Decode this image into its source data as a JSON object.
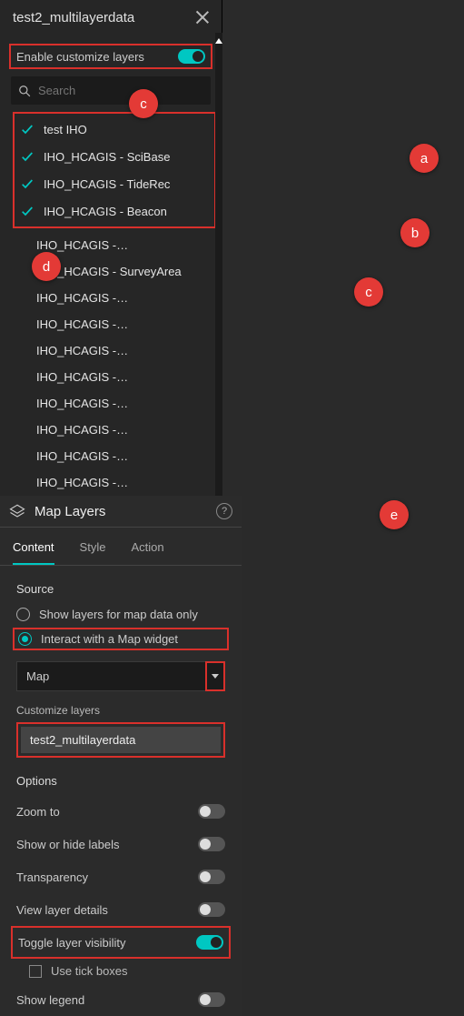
{
  "left": {
    "title": "test2_multilayerdata",
    "enable_label": "Enable customize layers",
    "search_placeholder": "Search",
    "layers_checked": [
      "test IHO",
      "IHO_HCAGIS - SciBase",
      "IHO_HCAGIS - TideRec",
      "IHO_HCAGIS - Beacon"
    ],
    "layers_rest": [
      "IHO_HCAGIS -…",
      "IHO_HCAGIS - SurveyArea",
      "IHO_HCAGIS -…",
      "IHO_HCAGIS -…",
      "IHO_HCAGIS -…",
      "IHO_HCAGIS -…",
      "IHO_HCAGIS -…",
      "IHO_HCAGIS -…",
      "IHO_HCAGIS -…",
      "IHO_HCAGIS -…"
    ]
  },
  "right": {
    "title": "Map Layers",
    "tabs": {
      "content": "Content",
      "style": "Style",
      "action": "Action"
    },
    "source_label": "Source",
    "radio1": "Show layers for map data only",
    "radio2": "Interact with a Map widget",
    "map_select": "Map",
    "customize_label": "Customize layers",
    "selected_layer": "test2_multilayerdata",
    "options_label": "Options",
    "opts": {
      "zoom": "Zoom to",
      "labels": "Show or hide labels",
      "transparency": "Transparency",
      "details": "View layer details",
      "toggle": "Toggle layer visibility",
      "tick": "Use tick boxes",
      "legend": "Show legend"
    }
  },
  "badges": {
    "a": "a",
    "b": "b",
    "c": "c",
    "d": "d",
    "e": "e"
  }
}
